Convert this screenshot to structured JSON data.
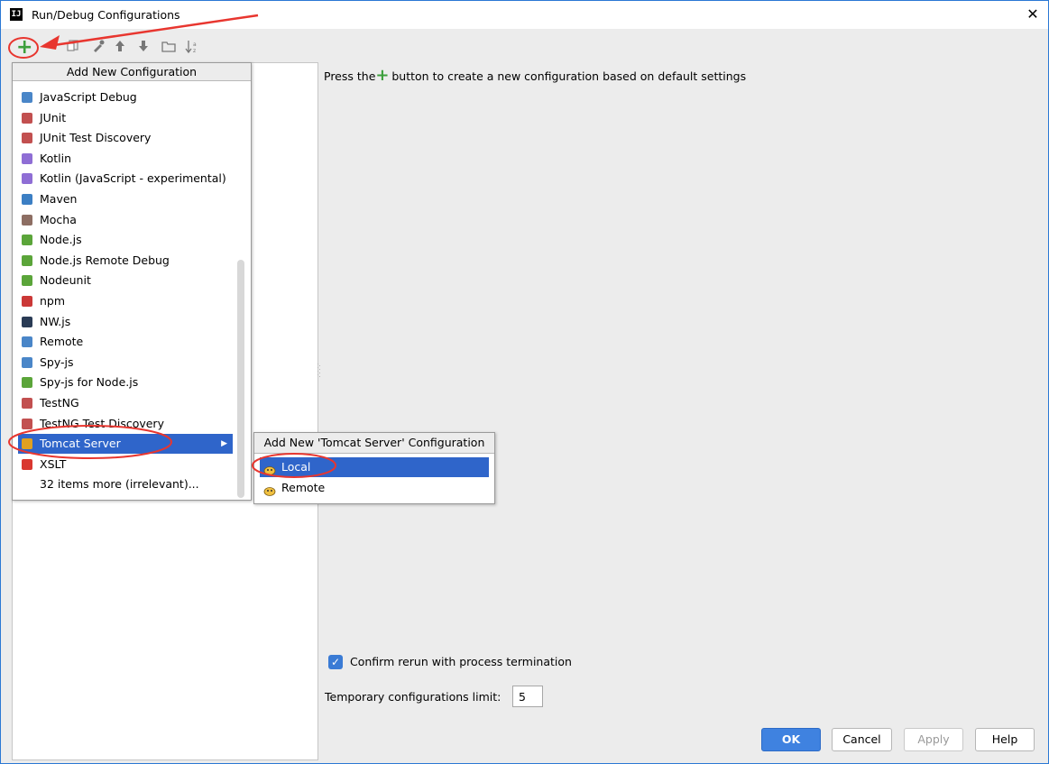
{
  "window": {
    "title": "Run/Debug Configurations",
    "app_icon_text": "IJ",
    "close_glyph": "✕"
  },
  "hint": {
    "before": "Press the",
    "plus": "+",
    "after": " button to create a new configuration based on default settings"
  },
  "popup": {
    "header": "Add New Configuration",
    "items": [
      {
        "label": "JavaScript Debug",
        "icon": "javascript-debug-icon",
        "color": "#4a86c8"
      },
      {
        "label": "JUnit",
        "icon": "junit-icon",
        "color": "#c25050"
      },
      {
        "label": "JUnit Test Discovery",
        "icon": "junit-test-discovery-icon",
        "color": "#c25050"
      },
      {
        "label": "Kotlin",
        "icon": "kotlin-icon",
        "color": "#8f6ed5"
      },
      {
        "label": "Kotlin (JavaScript - experimental)",
        "icon": "kotlin-js-icon",
        "color": "#8f6ed5"
      },
      {
        "label": "Maven",
        "icon": "maven-icon",
        "color": "#3c7fc4"
      },
      {
        "label": "Mocha",
        "icon": "mocha-icon",
        "color": "#8d6e63"
      },
      {
        "label": "Node.js",
        "icon": "nodejs-icon",
        "color": "#5ba53a"
      },
      {
        "label": "Node.js Remote Debug",
        "icon": "nodejs-remote-debug-icon",
        "color": "#5ba53a"
      },
      {
        "label": "Nodeunit",
        "icon": "nodeunit-icon",
        "color": "#5ba53a"
      },
      {
        "label": "npm",
        "icon": "npm-icon",
        "color": "#cb3837"
      },
      {
        "label": "NW.js",
        "icon": "nwjs-icon",
        "color": "#2a3b55"
      },
      {
        "label": "Remote",
        "icon": "remote-icon",
        "color": "#4a86c8"
      },
      {
        "label": "Spy-js",
        "icon": "spy-js-icon",
        "color": "#4a86c8"
      },
      {
        "label": "Spy-js for Node.js",
        "icon": "spy-js-node-icon",
        "color": "#5ba53a"
      },
      {
        "label": "TestNG",
        "icon": "testng-icon",
        "color": "#c25050"
      },
      {
        "label": "TestNG Test Discovery",
        "icon": "testng-test-discovery-icon",
        "color": "#c25050"
      },
      {
        "label": "Tomcat Server",
        "icon": "tomcat-icon",
        "color": "#e0a020",
        "selected": true,
        "has_submenu": true
      },
      {
        "label": "XSLT",
        "icon": "xslt-icon",
        "color": "#d9372f"
      },
      {
        "label": "32 items more (irrelevant)...",
        "icon": "",
        "color": ""
      }
    ]
  },
  "submenu": {
    "header": "Add New 'Tomcat Server' Configuration",
    "items": [
      {
        "label": "Local",
        "selected": true
      },
      {
        "label": "Remote",
        "selected": false
      }
    ]
  },
  "options": {
    "confirm_rerun": "Confirm rerun with process termination",
    "confirm_checked": true,
    "temp_limit_label": "Temporary configurations limit:",
    "temp_limit_value": "5"
  },
  "buttons": {
    "ok": "OK",
    "cancel": "Cancel",
    "apply": "Apply",
    "help": "Help"
  },
  "colors": {
    "selection": "#2f65ca",
    "accent_green": "#3c9f3c",
    "annotation_red": "#e8362f"
  }
}
